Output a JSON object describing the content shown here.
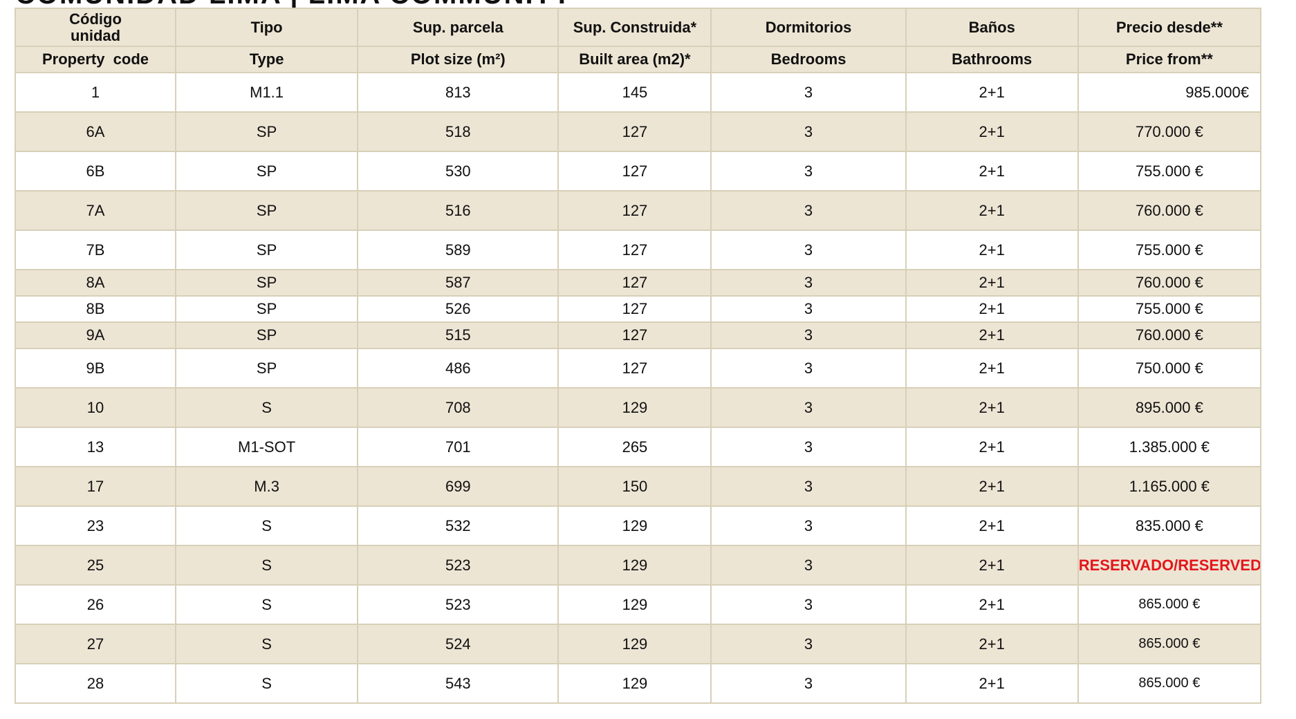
{
  "page_title": "COMUNIDAD LIMA | LIMA COMMUNITY",
  "columns": [
    {
      "es": "Código unidad",
      "en": "Property  code"
    },
    {
      "es": "Tipo",
      "en": "Type"
    },
    {
      "es": "Sup. parcela",
      "en": "Plot size (m²)"
    },
    {
      "es": "Sup. Construida*",
      "en": "Built area (m2)*"
    },
    {
      "es": "Dormitorios",
      "en": "Bedrooms"
    },
    {
      "es": "Baños",
      "en": "Bathrooms"
    },
    {
      "es": "Precio desde**",
      "en": "Price from**"
    }
  ],
  "rows": [
    {
      "code": "1",
      "type": "M1.1",
      "plot": "813",
      "built": "145",
      "bedrooms": "3",
      "bathrooms": "2+1",
      "price": "985.000€"
    },
    {
      "code": "6A",
      "type": "SP",
      "plot": "518",
      "built": "127",
      "bedrooms": "3",
      "bathrooms": "2+1",
      "price": "770.000 €"
    },
    {
      "code": "6B",
      "type": "SP",
      "plot": "530",
      "built": "127",
      "bedrooms": "3",
      "bathrooms": "2+1",
      "price": "755.000 €"
    },
    {
      "code": "7A",
      "type": "SP",
      "plot": "516",
      "built": "127",
      "bedrooms": "3",
      "bathrooms": "2+1",
      "price": "760.000 €"
    },
    {
      "code": "7B",
      "type": "SP",
      "plot": "589",
      "built": "127",
      "bedrooms": "3",
      "bathrooms": "2+1",
      "price": "755.000 €"
    },
    {
      "code": "8A",
      "type": "SP",
      "plot": "587",
      "built": "127",
      "bedrooms": "3",
      "bathrooms": "2+1",
      "price": "760.000 €"
    },
    {
      "code": "8B",
      "type": "SP",
      "plot": "526",
      "built": "127",
      "bedrooms": "3",
      "bathrooms": "2+1",
      "price": "755.000 €"
    },
    {
      "code": "9A",
      "type": "SP",
      "plot": "515",
      "built": "127",
      "bedrooms": "3",
      "bathrooms": "2+1",
      "price": "760.000 €"
    },
    {
      "code": "9B",
      "type": "SP",
      "plot": "486",
      "built": "127",
      "bedrooms": "3",
      "bathrooms": "2+1",
      "price": "750.000 €"
    },
    {
      "code": "10",
      "type": "S",
      "plot": "708",
      "built": "129",
      "bedrooms": "3",
      "bathrooms": "2+1",
      "price": "895.000 €"
    },
    {
      "code": "13",
      "type": "M1-SOT",
      "plot": "701",
      "built": "265",
      "bedrooms": "3",
      "bathrooms": "2+1",
      "price": "1.385.000 €"
    },
    {
      "code": "17",
      "type": "M.3",
      "plot": "699",
      "built": "150",
      "bedrooms": "3",
      "bathrooms": "2+1",
      "price": "1.165.000 €"
    },
    {
      "code": "23",
      "type": "S",
      "plot": "532",
      "built": "129",
      "bedrooms": "3",
      "bathrooms": "2+1",
      "price": "835.000 €"
    },
    {
      "code": "25",
      "type": "S",
      "plot": "523",
      "built": "129",
      "bedrooms": "3",
      "bathrooms": "2+1",
      "price": "RESERVADO/RESERVED",
      "reserved": true
    },
    {
      "code": "26",
      "type": "S",
      "plot": "523",
      "built": "129",
      "bedrooms": "3",
      "bathrooms": "2+1",
      "price": "865.000 €"
    },
    {
      "code": "27",
      "type": "S",
      "plot": "524",
      "built": "129",
      "bedrooms": "3",
      "bathrooms": "2+1",
      "price": "865.000 €"
    },
    {
      "code": "28",
      "type": "S",
      "plot": "543",
      "built": "129",
      "bedrooms": "3",
      "bathrooms": "2+1",
      "price": "865.000 €"
    }
  ],
  "colors": {
    "band": "#ede5d4",
    "border": "#d8cfb8",
    "reserved": "#e3161b"
  }
}
